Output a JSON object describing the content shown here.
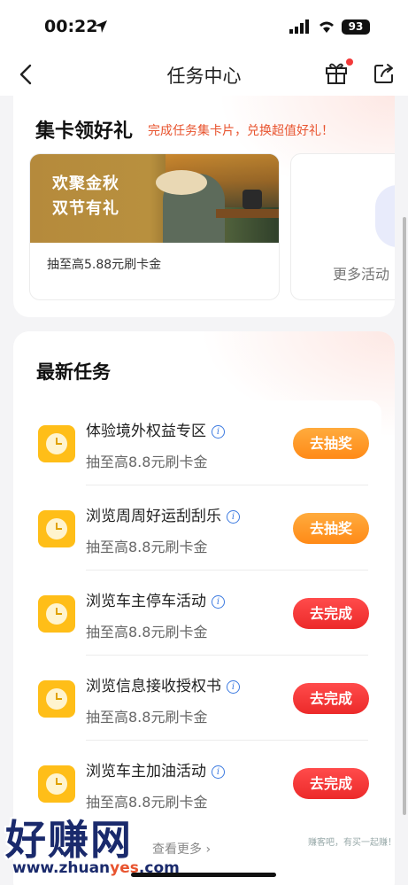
{
  "status_bar": {
    "time": "00:22",
    "battery": "93"
  },
  "nav": {
    "title": "任务中心"
  },
  "collect_card": {
    "title": "集卡领好礼",
    "subtitle": "完成任务集卡片，兑换超值好礼！",
    "promo": {
      "line1": "欢聚金秋",
      "line2": "双节有礼",
      "desc": "抽至高5.88元刷卡金"
    },
    "more_label": "更多活动"
  },
  "tasks_card": {
    "title": "最新任务",
    "tasks": [
      {
        "title": "体验境外权益专区",
        "sub": "抽至高8.8元刷卡金",
        "button": "去抽奖",
        "style": "orange"
      },
      {
        "title": "浏览周周好运刮刮乐",
        "sub": "抽至高8.8元刷卡金",
        "button": "去抽奖",
        "style": "orange"
      },
      {
        "title": "浏览车主停车活动",
        "sub": "抽至高8.8元刷卡金",
        "button": "去完成",
        "style": "red"
      },
      {
        "title": "浏览信息接收授权书",
        "sub": "抽至高8.8元刷卡金",
        "button": "去完成",
        "style": "red"
      },
      {
        "title": "浏览车主加油活动",
        "sub": "抽至高8.8元刷卡金",
        "button": "去完成",
        "style": "red"
      }
    ],
    "view_more": "查看更多 ›"
  },
  "watermark": {
    "brand": "好赚网",
    "url_pre": "www.zhuan",
    "url_em": "yes",
    "url_post": ".com",
    "right": "赚客吧，有买一起赚！"
  },
  "colors": {
    "accent_orange": "#ff8a17",
    "accent_red": "#ec2a2a",
    "clock_yellow": "#ffbe18",
    "link_blue": "#3c7ae0"
  }
}
